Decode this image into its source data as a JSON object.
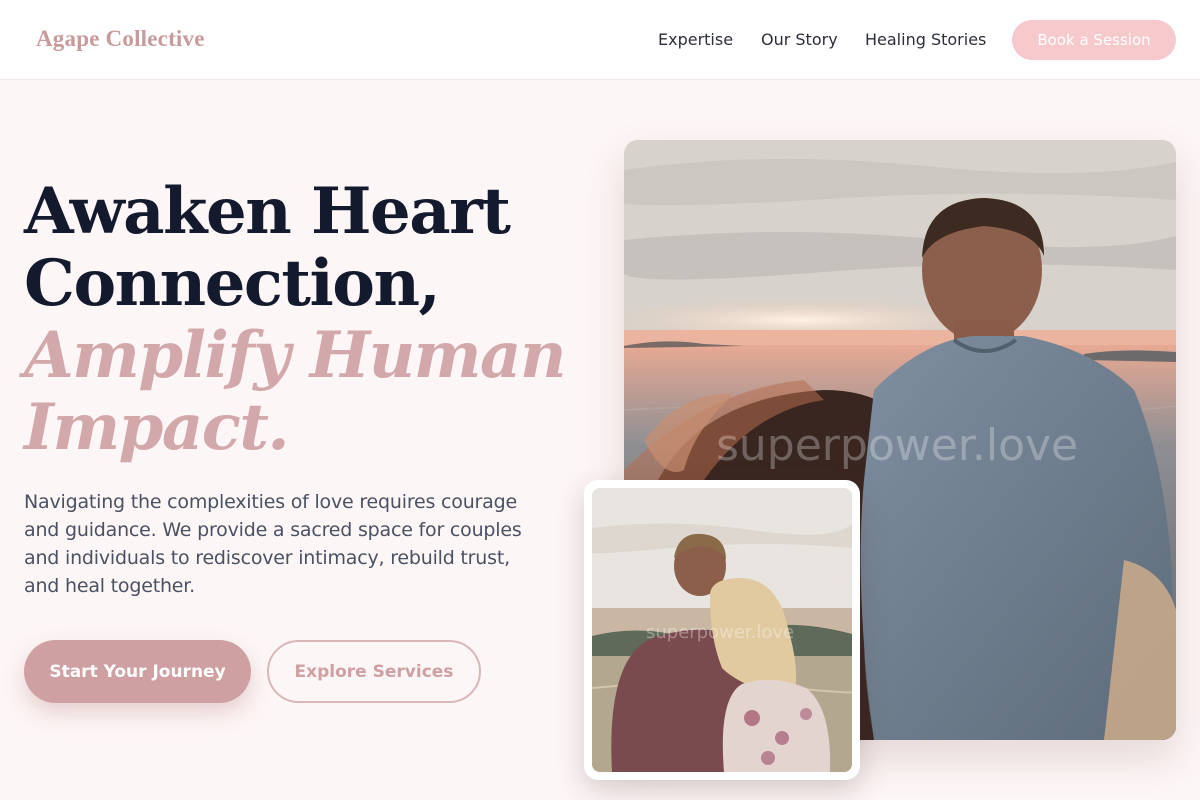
{
  "header": {
    "logo": "Agape Collective",
    "nav": {
      "expertise": "Expertise",
      "our_story": "Our Story",
      "healing_stories": "Healing Stories"
    },
    "cta_label": "Book a Session"
  },
  "hero": {
    "title_line1": "Awaken Heart",
    "title_line2": "Connection,",
    "title_line3": "Amplify Human",
    "title_line4": "Impact.",
    "description": "Navigating the complexities of love requires courage and guidance. We provide a sacred space for couples and individuals to rediscover intimacy, rebuild trust, and heal together.",
    "primary_button": "Start Your Journey",
    "secondary_button": "Explore Services"
  },
  "images": {
    "main_watermark": "superpower.love",
    "small_watermark": "superpower.love"
  },
  "colors": {
    "accent": "#cfa0a2",
    "accent_light": "#f6c9cc",
    "heading": "#141a2e",
    "body_text": "#4a5163",
    "page_background": "#fdf6f6"
  }
}
